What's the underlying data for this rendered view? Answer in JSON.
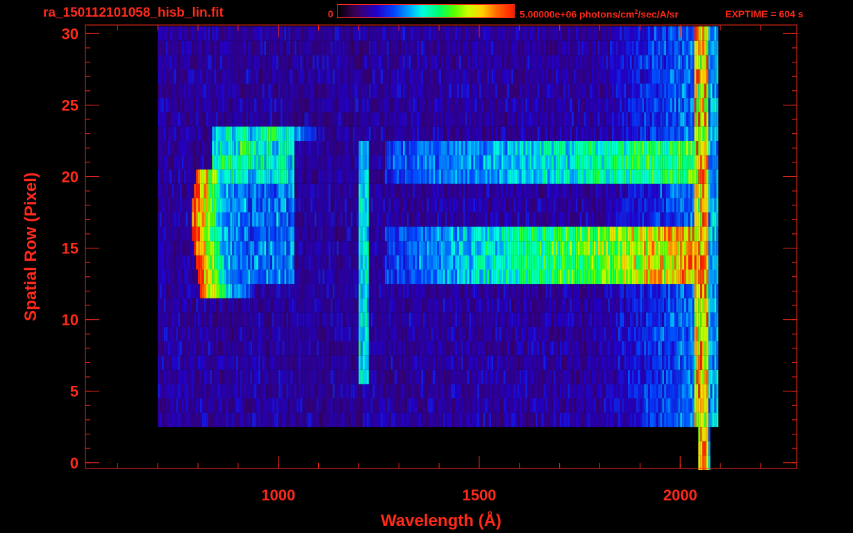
{
  "header": {
    "filename": "ra_150112101058_hisb_lin.fit",
    "colorbar_min": "0",
    "colorbar_max_prefix": "5.00000e+06 photons/cm",
    "colorbar_max_sup": "2",
    "colorbar_max_suffix": "/sec/A/sr",
    "exptime": "EXPTIME = 604 s"
  },
  "colors": {
    "frame": "#ff2a1a",
    "background": "#000000"
  },
  "chart_data": {
    "type": "heatmap",
    "xlabel": "Wavelength (Å)",
    "ylabel": "Spatial Row (Pixel)",
    "xlim": [
      520,
      2290
    ],
    "ylim": [
      -0.4,
      30.6
    ],
    "x_ticks": [
      1000,
      1500,
      2000
    ],
    "y_ticks": [
      0,
      5,
      10,
      15,
      20,
      25,
      30
    ],
    "colorbar": {
      "min": 0,
      "max": 5000000,
      "units": "photons/cm^2/sec/A/sr"
    },
    "features": [
      {
        "name": "arc",
        "x_range": [
          780,
          1040
        ],
        "row_range": [
          12,
          23
        ],
        "peak_rows": [
          13,
          20
        ],
        "peak_intensity": 1.0
      },
      {
        "name": "vertical line",
        "x": 1210,
        "row_range": [
          6,
          23
        ],
        "peak_intensity": 0.5
      },
      {
        "name": "upper band",
        "x_range": [
          1250,
          2060
        ],
        "row_range": [
          20,
          23
        ],
        "peak_intensity": 0.6
      },
      {
        "name": "lower band",
        "x_range": [
          1250,
          2060
        ],
        "row_range": [
          13,
          17
        ],
        "peak_intensity": 0.85
      },
      {
        "name": "detector edge",
        "x": 2050,
        "row_range": [
          1,
          30
        ],
        "peak_intensity": 0.7
      }
    ]
  }
}
